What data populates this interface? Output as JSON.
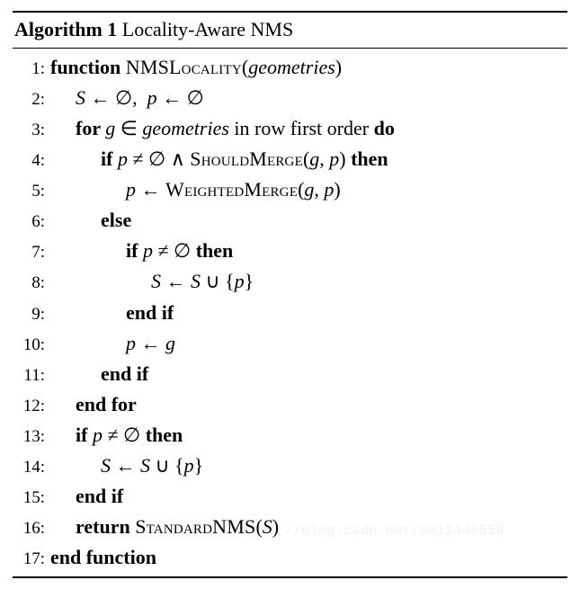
{
  "header": {
    "algo_label": "Algorithm 1",
    "algo_name": " Locality-Aware NMS"
  },
  "lines": [
    {
      "n": "1:",
      "ind": 0,
      "seg": [
        {
          "t": "function ",
          "c": "kw"
        },
        {
          "t": "NMSLocality",
          "c": "sc"
        },
        {
          "t": "("
        },
        {
          "t": "geometries",
          "c": "it"
        },
        {
          "t": ")"
        }
      ]
    },
    {
      "n": "2:",
      "ind": 1,
      "seg": [
        {
          "t": "S",
          "c": "it"
        },
        {
          "t": " ← ∅,  "
        },
        {
          "t": "p",
          "c": "it"
        },
        {
          "t": " ← ∅"
        }
      ]
    },
    {
      "n": "3:",
      "ind": 1,
      "seg": [
        {
          "t": "for ",
          "c": "kw"
        },
        {
          "t": "g",
          "c": "it"
        },
        {
          "t": " ∈ "
        },
        {
          "t": "geometries",
          "c": "it"
        },
        {
          "t": " in row first order "
        },
        {
          "t": "do",
          "c": "kw"
        }
      ]
    },
    {
      "n": "4:",
      "ind": 2,
      "seg": [
        {
          "t": "if ",
          "c": "kw"
        },
        {
          "t": "p",
          "c": "it"
        },
        {
          "t": " ≠ ∅ ∧ "
        },
        {
          "t": "ShouldMerge",
          "c": "sc"
        },
        {
          "t": "("
        },
        {
          "t": "g",
          "c": "it"
        },
        {
          "t": ", "
        },
        {
          "t": "p",
          "c": "it"
        },
        {
          "t": ") "
        },
        {
          "t": "then",
          "c": "kw"
        }
      ]
    },
    {
      "n": "5:",
      "ind": 3,
      "seg": [
        {
          "t": "p",
          "c": "it"
        },
        {
          "t": " ← "
        },
        {
          "t": "WeightedMerge",
          "c": "sc"
        },
        {
          "t": "("
        },
        {
          "t": "g",
          "c": "it"
        },
        {
          "t": ", "
        },
        {
          "t": "p",
          "c": "it"
        },
        {
          "t": ")"
        }
      ]
    },
    {
      "n": "6:",
      "ind": 2,
      "seg": [
        {
          "t": "else",
          "c": "kw"
        }
      ]
    },
    {
      "n": "7:",
      "ind": 3,
      "seg": [
        {
          "t": "if ",
          "c": "kw"
        },
        {
          "t": "p",
          "c": "it"
        },
        {
          "t": " ≠ ∅ "
        },
        {
          "t": "then",
          "c": "kw"
        }
      ]
    },
    {
      "n": "8:",
      "ind": 4,
      "seg": [
        {
          "t": "S",
          "c": "it"
        },
        {
          "t": " ← "
        },
        {
          "t": "S",
          "c": "it"
        },
        {
          "t": " ∪ {"
        },
        {
          "t": "p",
          "c": "it"
        },
        {
          "t": "}"
        }
      ]
    },
    {
      "n": "9:",
      "ind": 3,
      "seg": [
        {
          "t": "end if",
          "c": "kw"
        }
      ]
    },
    {
      "n": "10:",
      "ind": 3,
      "seg": [
        {
          "t": "p",
          "c": "it"
        },
        {
          "t": " ← "
        },
        {
          "t": "g",
          "c": "it"
        }
      ]
    },
    {
      "n": "11:",
      "ind": 2,
      "seg": [
        {
          "t": "end if",
          "c": "kw"
        }
      ]
    },
    {
      "n": "12:",
      "ind": 1,
      "seg": [
        {
          "t": "end for",
          "c": "kw"
        }
      ]
    },
    {
      "n": "13:",
      "ind": 1,
      "seg": [
        {
          "t": "if ",
          "c": "kw"
        },
        {
          "t": "p",
          "c": "it"
        },
        {
          "t": " ≠ ∅ "
        },
        {
          "t": "then",
          "c": "kw"
        }
      ]
    },
    {
      "n": "14:",
      "ind": 2,
      "seg": [
        {
          "t": "S",
          "c": "it"
        },
        {
          "t": " ← "
        },
        {
          "t": "S",
          "c": "it"
        },
        {
          "t": " ∪ {"
        },
        {
          "t": "p",
          "c": "it"
        },
        {
          "t": "}"
        }
      ]
    },
    {
      "n": "15:",
      "ind": 1,
      "seg": [
        {
          "t": "end if",
          "c": "kw"
        }
      ]
    },
    {
      "n": "16:",
      "ind": 1,
      "seg": [
        {
          "t": "return ",
          "c": "kw"
        },
        {
          "t": "StandardNMS",
          "c": "sc"
        },
        {
          "t": "("
        },
        {
          "t": "S",
          "c": "it"
        },
        {
          "t": ")"
        }
      ]
    },
    {
      "n": "17:",
      "ind": 0,
      "seg": [
        {
          "t": "end function",
          "c": "kw"
        }
      ]
    }
  ],
  "watermark": "https://blog.csdn.net/u011440558"
}
